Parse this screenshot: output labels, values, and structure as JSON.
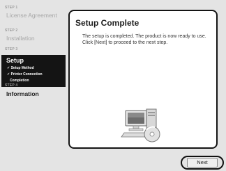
{
  "sidebar": {
    "steps": [
      {
        "num": "STEP 1",
        "title": "License Agreement"
      },
      {
        "num": "STEP 2",
        "title": "Installation"
      },
      {
        "num": "STEP 3",
        "title": "Setup",
        "subitems": [
          "✓ Setup Method",
          "✓ Printer Connection",
          "Completion"
        ]
      },
      {
        "num": "STEP 4",
        "title": "Information"
      }
    ]
  },
  "main": {
    "heading": "Setup Complete",
    "message": "The setup is completed. The product is now ready to use. Click [Next] to proceed to the next step.",
    "illustration_icon": "computer-with-cd-icon"
  },
  "footer": {
    "next_label": "Next"
  }
}
